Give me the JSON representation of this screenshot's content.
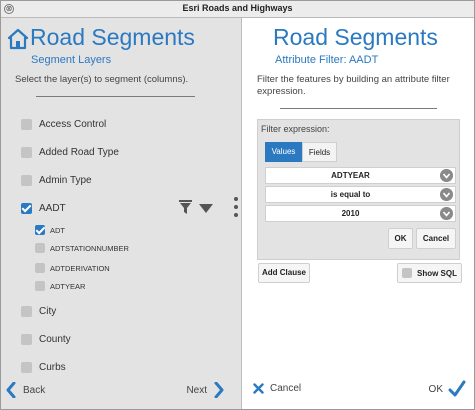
{
  "window": {
    "title": "Esri Roads and Highways",
    "close_glyph": "⊗"
  },
  "colors": {
    "accent": "#2a79c1",
    "panel_gray": "#e3e3e3",
    "dropdown_gray": "#8a8a8a"
  },
  "left": {
    "home_icon": "home-icon",
    "title": "Road Segments",
    "subtitle": "Segment Layers",
    "instruction": "Select the layer(s) to segment (columns).",
    "layers": [
      {
        "label": "Access Control",
        "checked": false
      },
      {
        "label": "Added Road Type",
        "checked": false
      },
      {
        "label": "Admin Type",
        "checked": false
      },
      {
        "label": "AADT",
        "checked": true
      },
      {
        "label": "City",
        "checked": false
      },
      {
        "label": "County",
        "checked": false
      },
      {
        "label": "Curbs",
        "checked": false
      }
    ],
    "sublayers": [
      {
        "label": "ADT",
        "checked": true
      },
      {
        "label": "ADTSTATIONNUMBER",
        "checked": false
      },
      {
        "label": "ADTDERIVATION",
        "checked": false
      },
      {
        "label": "ADTYEAR",
        "checked": false
      }
    ],
    "back_label": "Back",
    "next_label": "Next"
  },
  "right": {
    "title": "Road Segments",
    "subtitle": "Attribute Filter: AADT",
    "description": "Filter the features by building an attribute filter expression.",
    "filter_label": "Filter expression:",
    "tabs": {
      "values": "Values",
      "fields": "Fields",
      "active": "values"
    },
    "field_value": "ADTYEAR",
    "operator_value": "is equal to",
    "value_value": "2010",
    "ok_small": "OK",
    "cancel_small": "Cancel",
    "add_clause": "Add Clause",
    "show_sql": "Show SQL",
    "show_sql_checked": false,
    "cancel_label": "Cancel",
    "ok_label": "OK"
  }
}
